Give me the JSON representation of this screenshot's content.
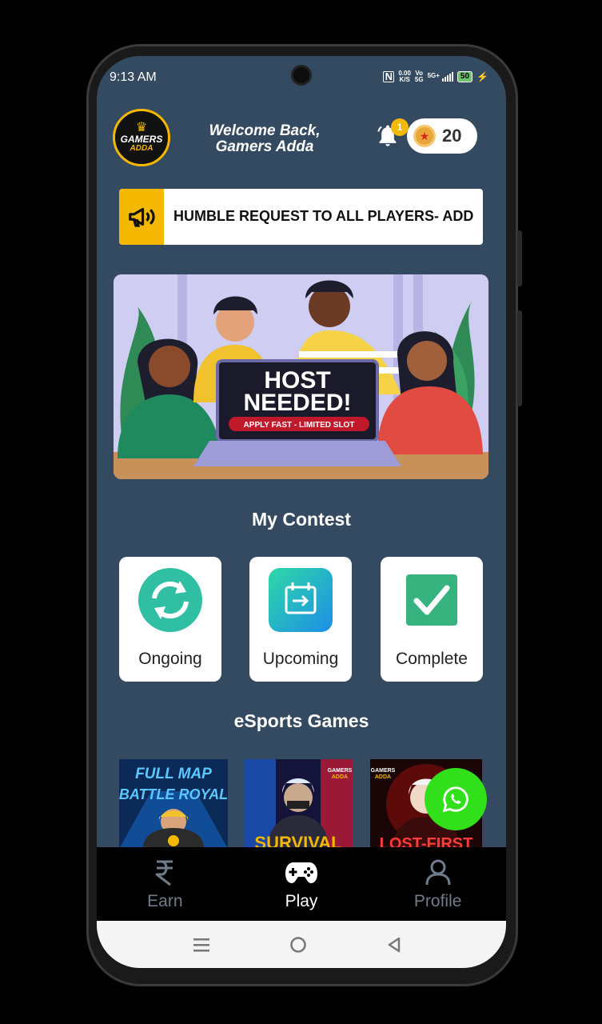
{
  "status_bar": {
    "time": "9:13 AM",
    "net_speed_value": "0.00",
    "net_speed_unit": "K/S",
    "volte_top": "Vo",
    "volte_bottom": "5G",
    "signal_label": "5G+",
    "battery": "50"
  },
  "header": {
    "logo_line1": "GAMERS",
    "logo_line2": "ADDA",
    "welcome_line1": "Welcome Back,",
    "welcome_line2": "Gamers Adda",
    "notification_count": "1",
    "coins": "20"
  },
  "notice": {
    "text": "HUMBLE REQUEST TO ALL PLAYERS- ADD"
  },
  "banner": {
    "title_line1": "HOST",
    "title_line2": "NEEDED!",
    "subtitle": "APPLY FAST - LIMITED SLOT"
  },
  "my_contest": {
    "title": "My Contest",
    "items": [
      {
        "label": "Ongoing"
      },
      {
        "label": "Upcoming"
      },
      {
        "label": "Complete"
      }
    ]
  },
  "esports": {
    "title": "eSports Games",
    "cards": [
      {
        "title_line1": "FULL MAP",
        "title_line2": "BATTLE ROYAL"
      },
      {
        "brand_line1": "GAMERS",
        "brand_line2": "ADDA",
        "title": "SURVIVAL"
      },
      {
        "brand_line1": "GAMERS",
        "brand_line2": "ADDA",
        "title": "LOST-FIRST"
      }
    ]
  },
  "bottom_nav": {
    "items": [
      {
        "label": "Earn",
        "icon": "rupee-icon"
      },
      {
        "label": "Play",
        "icon": "gamepad-icon"
      },
      {
        "label": "Profile",
        "icon": "user-icon"
      }
    ]
  },
  "colors": {
    "background": "#344a60",
    "accent": "#f5b800",
    "whatsapp": "#31e01a"
  }
}
